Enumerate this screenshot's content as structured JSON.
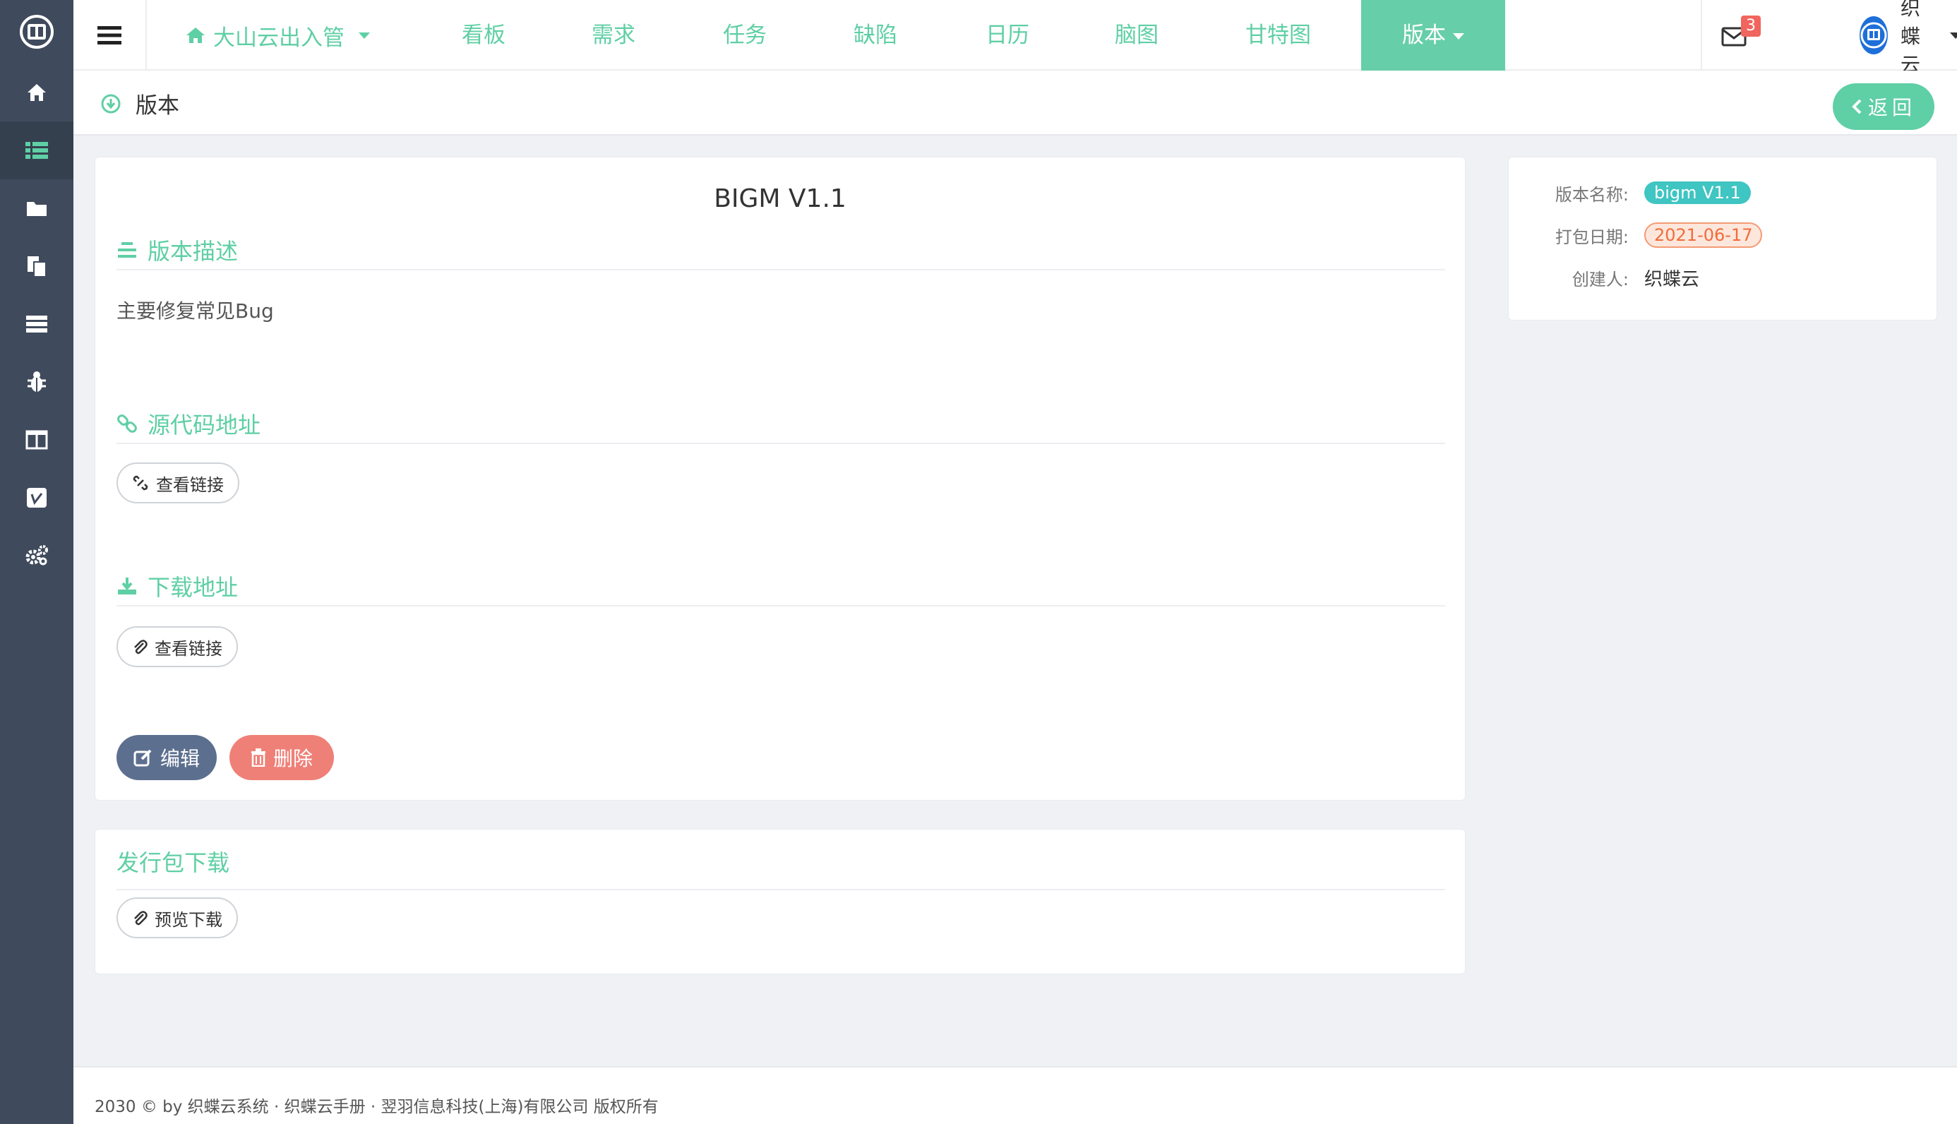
{
  "topbar": {
    "project_label": "大山云出入管",
    "nav": [
      "看板",
      "需求",
      "任务",
      "缺陷",
      "日历",
      "脑图",
      "甘特图"
    ],
    "active_label": "版本",
    "mail_count": "3",
    "user_name": "织蝶云"
  },
  "sidebar": {
    "icons": [
      "home-icon",
      "list-icon",
      "folder-icon",
      "copy-icon",
      "server-icon",
      "bug-icon",
      "columns-icon",
      "vimeo-icon",
      "cogs-icon"
    ],
    "active_index": 1
  },
  "page_header": {
    "title": "版本",
    "back_label": "返回"
  },
  "version": {
    "title": "BIGM V1.1",
    "desc_heading": "版本描述",
    "desc_text": "主要修复常见Bug",
    "source_heading": "源代码地址",
    "source_link_label": "查看链接",
    "download_heading": "下载地址",
    "download_link_label": "查看链接",
    "edit_label": "编辑",
    "delete_label": "删除"
  },
  "release": {
    "heading": "发行包下载",
    "preview_label": "预览下载"
  },
  "info": {
    "name_label": "版本名称:",
    "name_value": "bigm V1.1",
    "date_label": "打包日期:",
    "date_value": "2021-06-17",
    "creator_label": "创建人:",
    "creator_value": "织蝶云"
  },
  "footer": {
    "text": "2030 © by 织蝶云系统 · 织蝶云手册 · 翌羽信息科技(上海)有限公司 版权所有"
  },
  "colors": {
    "accent": "#5fcfa5",
    "sidebar": "#3f4a5c",
    "edit": "#5c6f8f",
    "delete": "#ef8077",
    "tag_green": "#3fc5c2",
    "tag_orange": "#f26b3a"
  }
}
